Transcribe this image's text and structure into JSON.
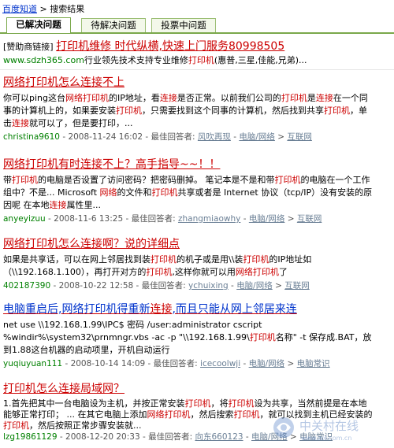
{
  "breadcrumb": {
    "home": "百度知道",
    "sep": " > ",
    "current": "搜索结果"
  },
  "tabs": [
    "已解决问题",
    "待解决问题",
    "投票中问题"
  ],
  "ad": {
    "tag": "[赞助商链接]",
    "title": "打印机维修 时代纵横,快速上门服务80998505",
    "url": "www.sdzh365.com",
    "desc_a": "行业领先技术支持专业维修",
    "desc_hl": "打印机",
    "desc_b": "(惠普,三星,佳能,兄弟)..."
  },
  "results": [
    {
      "title_parts": [
        "网络打印机怎么",
        "连接",
        "不上"
      ],
      "desc": "你可以ping这台网络打印机的IP地址，看连接是否正常。以前我们公司的打印机是连接在一个同事的计算机上的，如果要安装打印机，只需要找到这个同事的计算机，然后找到共享打印机，单击连接就可以了，但是要打印，...",
      "user": "christina9610",
      "date": " - 2008-11-24 16:02 - 最佳回答者: ",
      "answerer": "风吹再现",
      "sep1": " - ",
      "cat1": "电脑/网络",
      "sep2": " > ",
      "cat2": "互联网"
    },
    {
      "title_parts": [
        "网络打印机有时",
        "连接",
        "不上？高手指导~~！！"
      ],
      "desc": "带打印机的电脑是否设置了访问密码？把密码删掉。 笔记本是不是和带打印机的电脑在一个工作组中？不是... Microsoft 网络的文件和打印机共享或者是 Internet 协议（tcp/IP）没有安装的原因呢 在本地连接属性里...",
      "user": "anyeyizuu",
      "date": " - 2008-11-6 13:25 - 最佳回答者: ",
      "answerer": "zhangmiaowhy",
      "sep1": " - ",
      "cat1": "电脑/网络",
      "sep2": " > ",
      "cat2": "互联网"
    },
    {
      "title_parts": [
        "网络打印机怎么",
        "连接",
        "啊？说的详细点"
      ],
      "desc": "如果是共享话，可以在网上邻居找到装打印机的机子或是用\\\\装打印机的IP地址如（\\\\192.168.1.100），再打开对方的打印机,这样你就可以用网络打印机了",
      "user": "402187390",
      "date": " - 2008-10-22 12:58 - 最佳回答者: ",
      "answerer": "ychuixing",
      "sep1": " - ",
      "cat1": "电脑/网络",
      "sep2": " > ",
      "cat2": "互联网"
    },
    {
      "title_parts": [
        "电脑重启后,网络打印机得重新",
        "连接",
        ",而且只能从网上邻居来连"
      ],
      "desc": "net use \\\\192.168.1.99\\IPC$ 密码 /user:administrator cscript %windir%\\system32\\prnmngr.vbs -ac -p \"\\\\192.168.1.99\\打印机名称\" -t 保存成.BAT，放到1.88这台机器的启动项里，开机自动运行",
      "user": "yuqiuyuan111",
      "date": " - 2008-10-14 14:09 - 最佳回答者: ",
      "answerer": "icecoolwji",
      "sep1": " - ",
      "cat1": "电脑/网络",
      "sep2": " > ",
      "cat2": "电脑常识"
    },
    {
      "title_parts": [
        "打印机怎么",
        "连接",
        "局域网？"
      ],
      "desc": "1.首先把其中一台电脑设为主机，并按正常安装打印机，将打印机设为共享，当然前提是在本地能够正常打印； ... 在其它电脑上添加网络打印机，然后搜索打印机，就可以找到主机已经安装的打印机，然后按照正常步骤安装就...",
      "user": "lzg19861129",
      "date": " - 2008-12-20 20:33 - 最佳回答者: ",
      "answerer": "向东660123",
      "sep1": " - ",
      "cat1": "电脑/网络",
      "sep2": " > ",
      "cat2": "电脑常识"
    }
  ],
  "watermark": {
    "site": "中关村在线",
    "url": "www.zol.com.cn"
  }
}
